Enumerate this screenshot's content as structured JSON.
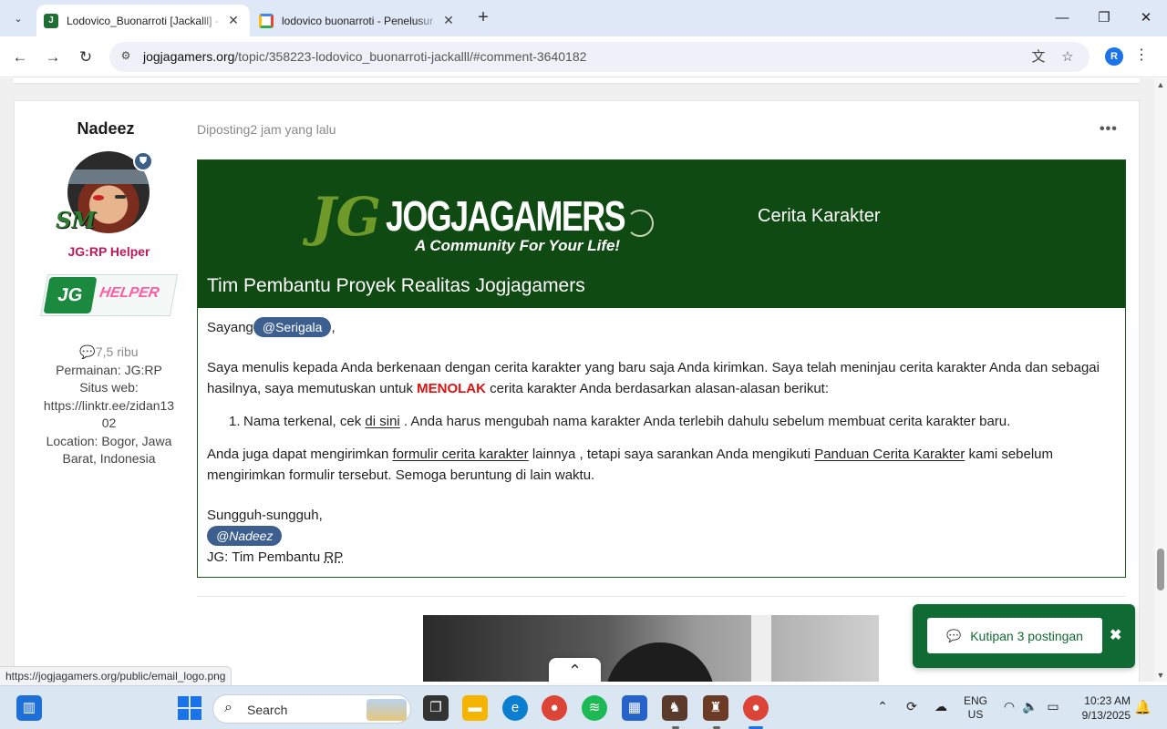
{
  "browser": {
    "tabs": [
      {
        "title": "Lodovico_Buonarroti [Jackalll] -",
        "active": true
      },
      {
        "title": "lodovico buonarroti - Penelusur",
        "active": false
      }
    ],
    "url_host": "jogjagamers.org",
    "url_path": "/topic/358223-lodovico_buonarroti-jackalll/#comment-3640182",
    "profile_initial": "R"
  },
  "post": {
    "author_name": "Nadeez",
    "group_title": "JG:RP Helper",
    "rank_badge_text": "SM",
    "helper_badge_text": "HELPER",
    "stats": {
      "post_count": "7,5 ribu",
      "game": "Permainan: JG:RP",
      "website_label": "Situs web:",
      "website_value": "https://linktr.ee/zidan13",
      "website_value_cont": "02",
      "location_label": "Location: Bogor, Jawa",
      "location_cont": "Barat, Indonesia"
    },
    "posted_prefix": "Diposting",
    "posted_time": "2 jam yang lalu",
    "email": {
      "logo_jg": "JG",
      "logo_word": "JOGJAGAMERS",
      "logo_tagline": "A Community For Your Life!",
      "header_right": "Cerita Karakter",
      "header_title": "Tim Pembantu Proyek Realitas Jogjagamers",
      "greeting": "Sayang",
      "mention_to": "@Serigala",
      "body_p1_a": "Saya menulis kepada Anda berkenaan dengan cerita karakter yang baru saja Anda kirimkan. Saya telah meninjau cerita karakter Anda dan sebagai hasilnya, saya memutuskan untuk ",
      "reject_word": "MENOLAK",
      "body_p1_b": " cerita karakter Anda berdasarkan alasan-alasan berikut:",
      "reason_num": "1.",
      "reason_a": "Nama terkenal, cek ",
      "reason_link": "di sini",
      "reason_b": " . Anda harus mengubah nama karakter Anda terlebih dahulu sebelum membuat cerita karakter baru.",
      "body_p2_a": "Anda juga dapat mengirimkan ",
      "link_form": "formulir cerita karakter",
      "body_p2_b": " lainnya , tetapi saya sarankan Anda mengikuti ",
      "link_guide": "Panduan Cerita Karakter",
      "body_p2_c": " kami sebelum mengirimkan formulir tersebut. Semoga beruntung di lain waktu.",
      "closing": "Sungguh-sungguh,",
      "mention_from": "@Nadeez",
      "signature_a": "JG: Tim Pembantu ",
      "signature_abbr": "RP"
    }
  },
  "quote_panel": {
    "label": "Kutipan 3 postingan",
    "close": "✖"
  },
  "status_url": "https://jogjagamers.org/public/email_logo.png",
  "taskbar": {
    "search_placeholder": "Search",
    "lang_1": "ENG",
    "lang_2": "US",
    "time": "10:23 AM",
    "date": "9/13/2025"
  }
}
